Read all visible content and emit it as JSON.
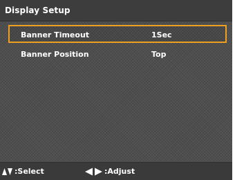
{
  "title": "Display Setup",
  "menu": {
    "items": [
      {
        "label": "Banner Timeout",
        "value": "1Sec"
      },
      {
        "label": "Banner Position",
        "value": "Top"
      }
    ]
  },
  "footer": {
    "select_label": ":Select",
    "adjust_label": ":Adjust"
  },
  "colors": {
    "highlight": "#f0a020",
    "text": "#ffffff"
  },
  "icons": {
    "select": "up-down-arrows-icon",
    "adjust": "left-right-arrows-icon"
  }
}
